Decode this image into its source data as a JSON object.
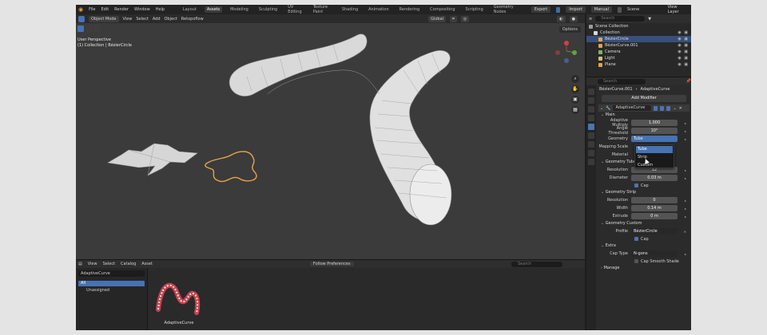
{
  "topbar": {
    "menus": [
      "File",
      "Edit",
      "Render",
      "Window",
      "Help"
    ],
    "workspaces": [
      "Layout",
      "Assets",
      "Modeling",
      "Sculpting",
      "UV Editing",
      "Texture Paint",
      "Shading",
      "Animation",
      "Rendering",
      "Compositing",
      "Scripting",
      "Geometry Nodes"
    ],
    "active_workspace": "Assets",
    "right_buttons": [
      "Export",
      "Import",
      "Manual"
    ],
    "scene_label": "Scene",
    "view_layer_label": "View Layer"
  },
  "viewport": {
    "mode": "Object Mode",
    "menus": [
      "View",
      "Select",
      "Add",
      "Object"
    ],
    "retopoflow": "Retopoflow",
    "orientation": "Global",
    "perspective_text": "User Perspective",
    "collection_text": "(1) Collection | BézierCircle",
    "options_label": "Options"
  },
  "asset_browser": {
    "menus": [
      "View",
      "Select",
      "Catalog",
      "Asset"
    ],
    "import_setting": "Follow Preferences",
    "search_placeholder": "Search",
    "library": "AdaptiveCurve",
    "catalog_all": "All",
    "catalog_unassigned": "Unassigned",
    "asset_name": "AdaptiveCurve"
  },
  "outliner": {
    "search_placeholder": "Search",
    "items": [
      {
        "label": "Scene Collection",
        "indent": 0,
        "color": "#9a9a9a",
        "selected": false
      },
      {
        "label": "Collection",
        "indent": 1,
        "color": "#d8d8d8",
        "selected": false
      },
      {
        "label": "BézierCircle",
        "indent": 2,
        "color": "#e8a24a",
        "selected": true
      },
      {
        "label": "BézierCurve.001",
        "indent": 2,
        "color": "#e8a24a",
        "selected": false
      },
      {
        "label": "Camera",
        "indent": 2,
        "color": "#7fb26a",
        "selected": false
      },
      {
        "label": "Light",
        "indent": 2,
        "color": "#d4c06a",
        "selected": false
      },
      {
        "label": "Plane",
        "indent": 2,
        "color": "#e8a24a",
        "selected": false
      }
    ]
  },
  "properties": {
    "search_placeholder": "Search",
    "object_name": "BézierCurve.001",
    "modifier_crumb": "AdaptiveCurve",
    "add_modifier": "Add Modifier",
    "modifier_name": "AdaptiveCurve",
    "main_section": "Main",
    "adaptive_multiply_label": "Adaptive Multiply",
    "adaptive_multiply_value": "1.000",
    "angle_threshold_label": "Angle Threshold",
    "angle_threshold_value": "10°",
    "geometry_label": "Geometry",
    "geometry_value": "Tube",
    "mapping_scale_label": "Mapping Scale",
    "material_label": "Material",
    "geometry_tube_section": "Geometry Tube",
    "tube_resolution_label": "Resolution",
    "tube_resolution_value": "12",
    "diameter_label": "Diameter",
    "diameter_value": "0.03 m",
    "cap_label": "Cap",
    "geometry_strip_section": "Geometry Strip",
    "strip_resolution_label": "Resolution",
    "strip_resolution_value": "0",
    "width_label": "Width",
    "width_value": "0.14 m",
    "extrude_label": "Extrude",
    "extrude_value": "0 m",
    "geometry_custom_section": "Geometry Custom",
    "profile_label": "Profile",
    "profile_value": "BézierCircle",
    "custom_cap_label": "Cap",
    "extra_section": "Extra",
    "cap_type_label": "Cap Type",
    "cap_type_value": "N-gons",
    "cap_smooth_label": "Cap Smooth Shade",
    "manage_section": "Manage"
  },
  "dropdown": {
    "options": [
      "Tube",
      "Strip",
      "Custom"
    ],
    "highlighted": "Tube"
  }
}
